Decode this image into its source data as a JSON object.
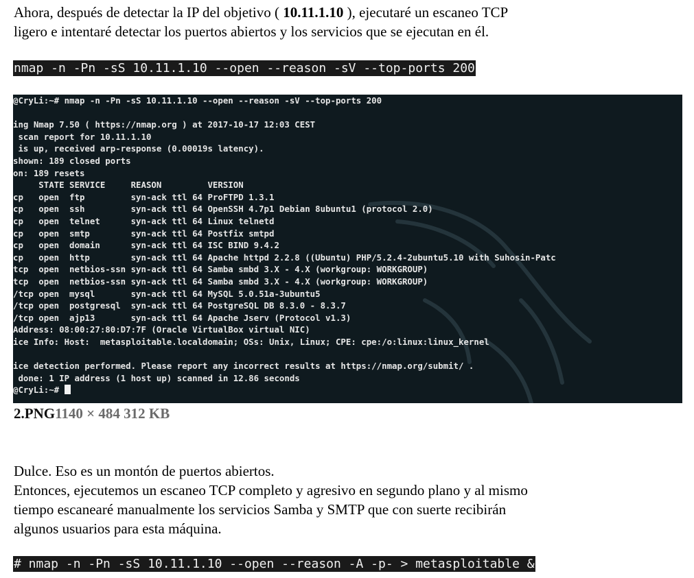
{
  "intro": {
    "line1_before": "Ahora, después de detectar la IP del objetivo ( ",
    "ip": "10.11.1.10",
    "line1_after": " ), ejecutaré un escaneo TCP",
    "line2": "ligero e intentaré detectar los puertos abiertos y los servicios que se ejecutan en él."
  },
  "command1": "nmap -n -Pn -sS 10.11.1.10 --open --reason -sV --top-ports 200",
  "terminal": {
    "lines": [
      "@CryLi:~# nmap -n -Pn -sS 10.11.1.10 --open --reason -sV --top-ports 200",
      "",
      "ing Nmap 7.50 ( https://nmap.org ) at 2017-10-17 12:03 CEST",
      " scan report for 10.11.1.10",
      " is up, received arp-response (0.00019s latency).",
      "shown: 189 closed ports",
      "on: 189 resets",
      "     STATE SERVICE     REASON         VERSION",
      "cp   open  ftp         syn-ack ttl 64 ProFTPD 1.3.1",
      "cp   open  ssh         syn-ack ttl 64 OpenSSH 4.7p1 Debian 8ubuntu1 (protocol 2.0)",
      "cp   open  telnet      syn-ack ttl 64 Linux telnetd",
      "cp   open  smtp        syn-ack ttl 64 Postfix smtpd",
      "cp   open  domain      syn-ack ttl 64 ISC BIND 9.4.2",
      "cp   open  http        syn-ack ttl 64 Apache httpd 2.2.8 ((Ubuntu) PHP/5.2.4-2ubuntu5.10 with Suhosin-Patc",
      "tcp  open  netbios-ssn syn-ack ttl 64 Samba smbd 3.X - 4.X (workgroup: WORKGROUP)",
      "tcp  open  netbios-ssn syn-ack ttl 64 Samba smbd 3.X - 4.X (workgroup: WORKGROUP)",
      "/tcp open  mysql       syn-ack ttl 64 MySQL 5.0.51a-3ubuntu5",
      "/tcp open  postgresql  syn-ack ttl 64 PostgreSQL DB 8.3.0 - 8.3.7",
      "/tcp open  ajp13       syn-ack ttl 64 Apache Jserv (Protocol v1.3)",
      "Address: 08:00:27:80:D7:7F (Oracle VirtualBox virtual NIC)",
      "ice Info: Host:  metasploitable.localdomain; OSs: Unix, Linux; CPE: cpe:/o:linux:linux_kernel",
      "",
      "ice detection performed. Please report any incorrect results at https://nmap.org/submit/ .",
      " done: 1 IP address (1 host up) scanned in 12.86 seconds",
      "@CryLi:~# "
    ]
  },
  "caption": {
    "name": "2.PNG",
    "meta": "1140 × 484 312 KB"
  },
  "body": {
    "line1": "Dulce. Eso es un montón de puertos abiertos.",
    "line2": "Entonces, ejecutemos un escaneo TCP completo y agresivo en segundo plano y al mismo",
    "line3": "tiempo escanearé manualmente los servicios Samba y SMTP que con suerte recibirán",
    "line4": "algunos usuarios para esta máquina."
  },
  "command2": "# nmap -n -Pn -sS 10.11.1.10 --open --reason -A -p- > metasploitable &"
}
